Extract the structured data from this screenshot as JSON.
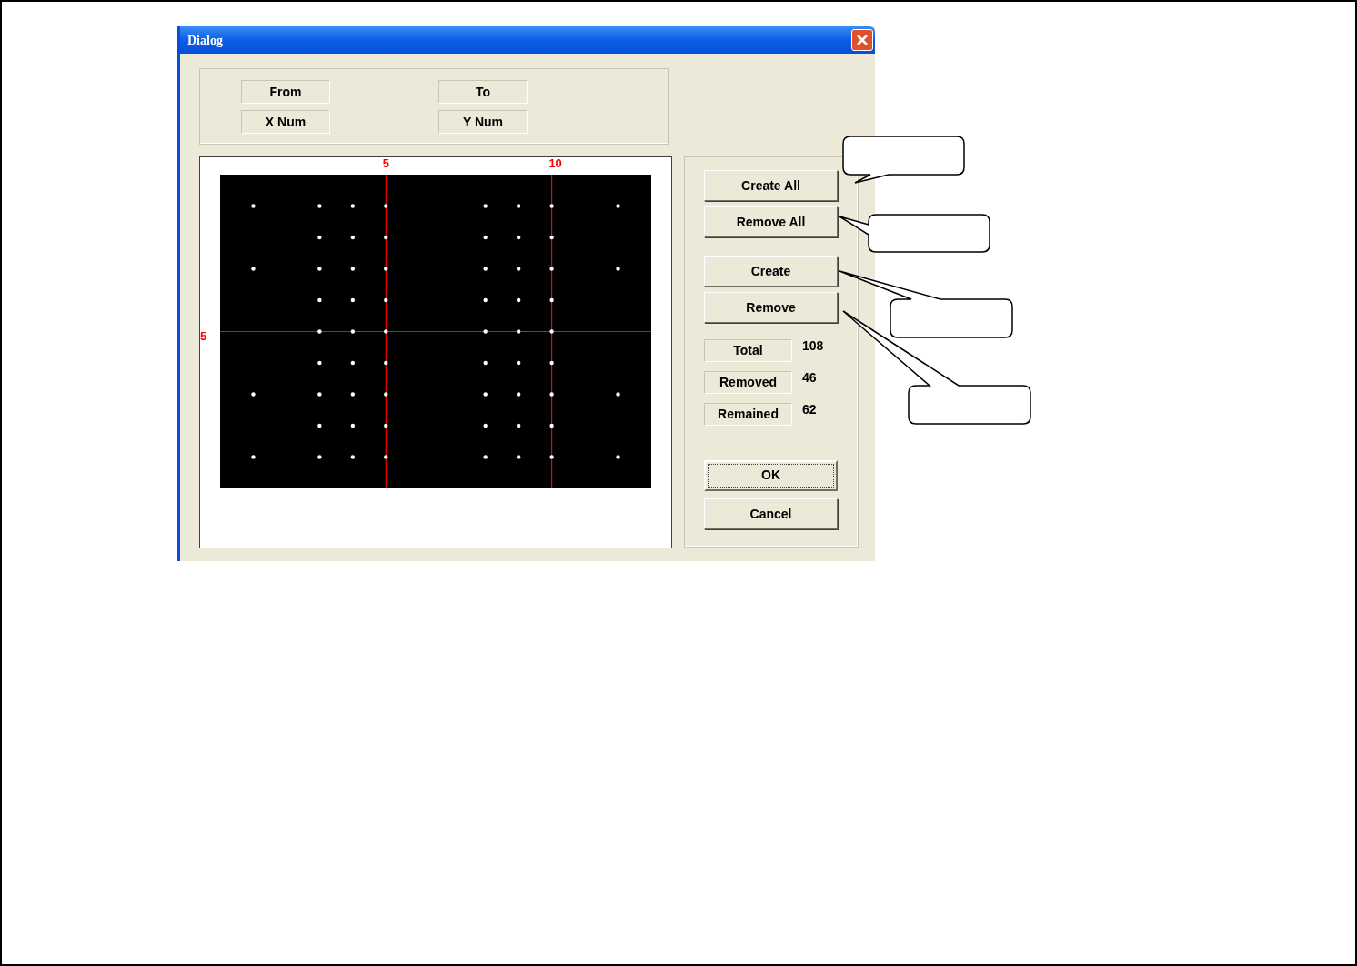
{
  "window": {
    "title": "Dialog"
  },
  "range_labels": [
    "From",
    "To",
    "X Num",
    "Y Num"
  ],
  "plot": {
    "column_labels": [
      "5",
      "10"
    ],
    "row_labels": [
      "5"
    ]
  },
  "button_groups": [
    [
      "Create All",
      "Remove All"
    ],
    [
      "Create",
      "Remove"
    ]
  ],
  "stats": [
    {
      "label": "Total",
      "value": "108"
    },
    {
      "label": "Removed",
      "value": "46"
    },
    {
      "label": "Remained",
      "value": "62"
    }
  ],
  "dialog_buttons": [
    {
      "label": "OK",
      "default": true
    },
    {
      "label": "Cancel",
      "default": false
    }
  ]
}
